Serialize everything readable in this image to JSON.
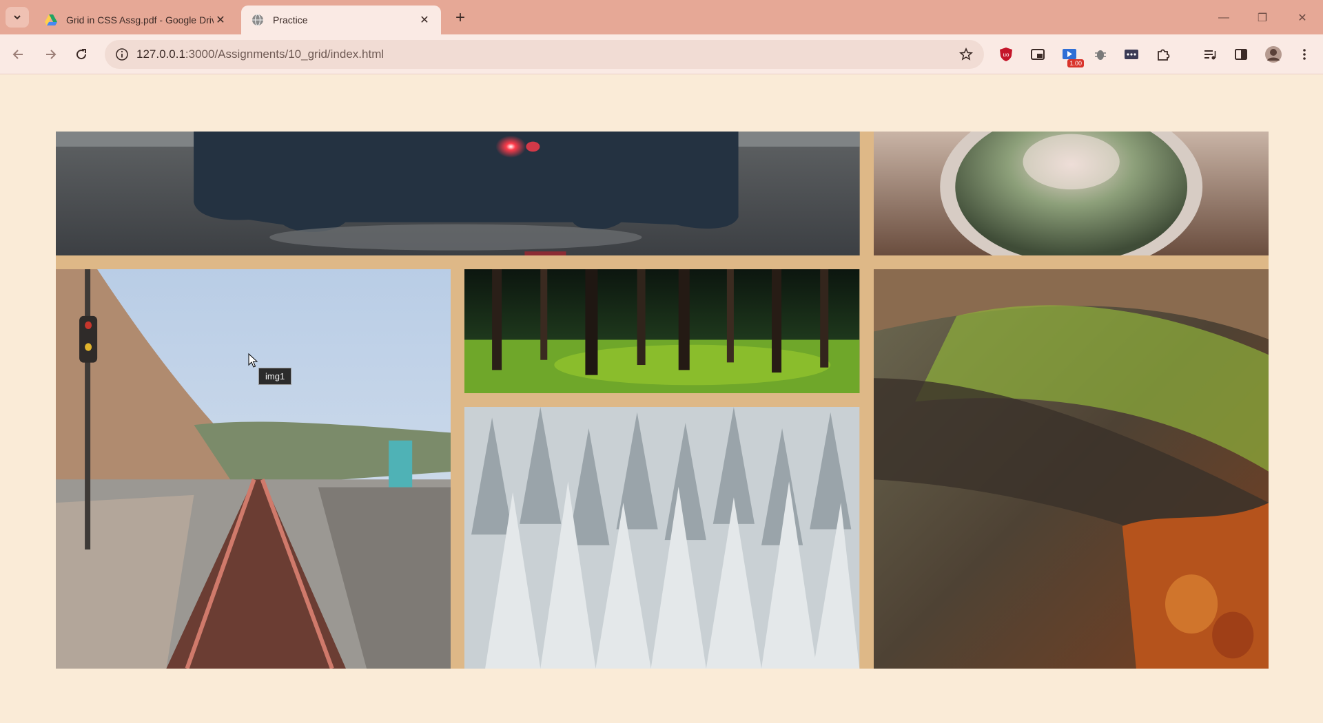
{
  "tabs": [
    {
      "title": "Grid in CSS Assg.pdf - Google Drive",
      "favicon": "google-drive-icon",
      "active": false
    },
    {
      "title": "Practice",
      "favicon": "globe-icon",
      "active": true
    }
  ],
  "tab_close_glyph": "✕",
  "new_tab_glyph": "+",
  "window_controls": {
    "minimize": "—",
    "restore": "❐",
    "close": "✕"
  },
  "toolbar": {
    "url_host": "127.0.0.1",
    "url_path": ":3000/Assignments/10_grid/index.html"
  },
  "extensions": [
    {
      "name": "ublock-icon",
      "color": "#c4162a"
    },
    {
      "name": "picture-in-picture-icon",
      "color": "#3b2a26"
    },
    {
      "name": "video-speed-icon",
      "badge": "1.00",
      "color": "#2f6fd6"
    },
    {
      "name": "bug-icon",
      "color": "#6b6b6b"
    },
    {
      "name": "password-manager-icon",
      "color": "#3b3b55"
    },
    {
      "name": "extensions-puzzle-icon",
      "color": "#3b2a26"
    },
    {
      "name": "media-control-icon",
      "color": "#3b2a26"
    },
    {
      "name": "side-panel-icon",
      "color": "#3b2a26"
    },
    {
      "name": "profile-avatar-icon",
      "color": "#7a5f55"
    },
    {
      "name": "menu-kebab-icon",
      "color": "#3b2a26"
    }
  ],
  "grid": {
    "images": [
      "img1",
      "img2",
      "img3",
      "img4",
      "img5",
      "img6"
    ],
    "background": "#deb887",
    "page_background": "#faebd7"
  },
  "tooltip": "img1"
}
